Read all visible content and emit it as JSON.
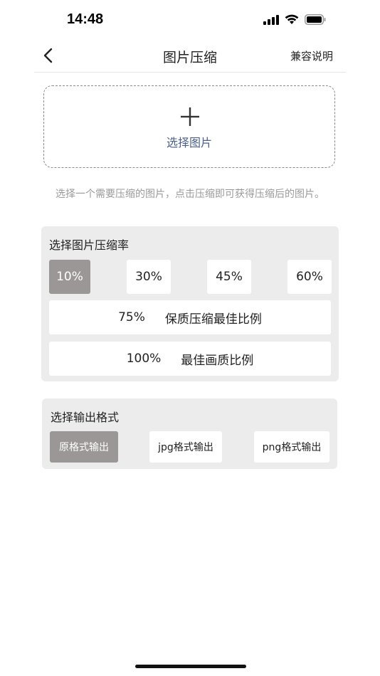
{
  "status": {
    "time": "14:48"
  },
  "nav": {
    "title": "图片压缩",
    "right_label": "兼容说明"
  },
  "upload": {
    "label": "选择图片"
  },
  "hint": "选择一个需要压缩的图片，点击压缩即可获得压缩后的图片。",
  "compression": {
    "title": "选择图片压缩率",
    "options": [
      "10%",
      "30%",
      "45%",
      "60%"
    ],
    "wide_options": [
      {
        "value": "75%",
        "desc": "保质压缩最佳比例"
      },
      {
        "value": "100%",
        "desc": "最佳画质比例"
      }
    ],
    "selected": "10%"
  },
  "format": {
    "title": "选择输出格式",
    "options": [
      "原格式输出",
      "jpg格式输出",
      "png格式输出"
    ],
    "selected": "原格式输出"
  },
  "colors": {
    "selected_bg": "#9a9796",
    "panel_bg": "#ececec",
    "upload_label": "#4d6088",
    "hint_text": "#9a9a9a"
  },
  "icons": [
    "signal-icon",
    "wifi-icon",
    "battery-icon",
    "back-chevron-icon",
    "plus-icon"
  ]
}
